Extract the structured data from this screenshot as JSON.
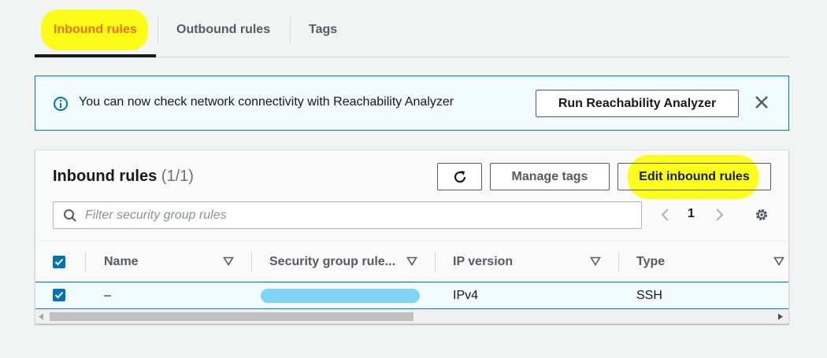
{
  "tabs": [
    {
      "label": "Inbound rules",
      "active": true
    },
    {
      "label": "Outbound rules",
      "active": false
    },
    {
      "label": "Tags",
      "active": false
    }
  ],
  "flash": {
    "message": "You can now check network connectivity with Reachability Analyzer",
    "action_label": "Run Reachability Analyzer",
    "icon": "info-icon",
    "dismiss_icon": "close-icon"
  },
  "panel": {
    "title": "Inbound rules",
    "count": "(1/1)",
    "refresh_icon": "refresh-icon",
    "manage_tags_label": "Manage tags",
    "edit_label": "Edit inbound rules"
  },
  "search": {
    "placeholder": "Filter security group rules",
    "value": ""
  },
  "pagination": {
    "current_page": "1"
  },
  "table": {
    "columns": [
      "Name",
      "Security group rule...",
      "IP version",
      "Type"
    ],
    "rows": [
      {
        "selected": true,
        "name": "–",
        "rule_id": "",
        "ip_version": "IPv4",
        "type": "SSH"
      }
    ]
  },
  "colors": {
    "accent": "#ec7211",
    "primary_blue": "#0073bb",
    "annotation_highlight": "#fdfd00",
    "redaction": "#7fd4f7"
  }
}
